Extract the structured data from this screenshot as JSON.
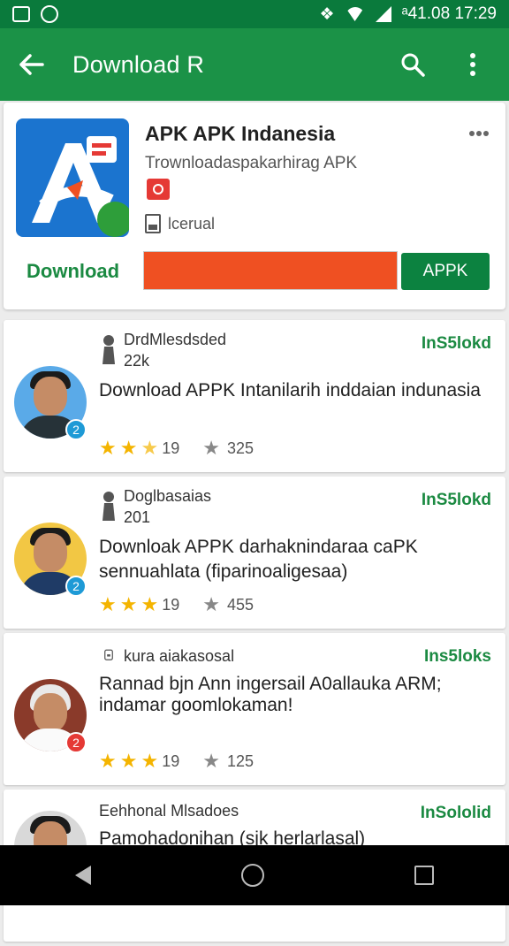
{
  "status_bar": {
    "right_text": "ᵃ41.08 17:29"
  },
  "appbar": {
    "title": "Download R"
  },
  "app": {
    "name": "APK APK Indanesia",
    "developer": "Trownloadaspakarhirag APK",
    "meta_text": "lcerual",
    "download_label": "Download",
    "progress_percent": 100,
    "apk_button": "APPK",
    "accent_color": "#ef5022",
    "brand_color": "#1b9247"
  },
  "reviews": [
    {
      "name": "DrdMlesdsded",
      "sub": "22k",
      "status": "InS5lokd",
      "text": "Download APPK Intanilarih inddaian indunasia",
      "rating": "19",
      "count": "325",
      "stars_full": 2,
      "badge": "2",
      "badge_color": "#1e9ad6"
    },
    {
      "name": "Doglbasaias",
      "sub": "201",
      "status": "InS5lokd",
      "text": "Downloak APPK darhaknindaraa caPK sennuahlata (fiparinoaligesaa)",
      "rating": "19",
      "count": "455",
      "stars_full": 3,
      "badge": "2",
      "badge_color": "#1e9ad6"
    },
    {
      "name": "kura aiakasosal",
      "sub": "",
      "status": "Ins5loks",
      "text": "Rannad bjn Ann ingersail A0allauka ARM; indamar goomlokaman!",
      "rating": "19",
      "count": "125",
      "stars_full": 3,
      "badge": "2",
      "badge_color": "#e53935"
    },
    {
      "name": "Eehhonal Mlsadoes",
      "sub": "",
      "status": "InSololid",
      "text": "Pamohadonihan (sjk herlarlasal)",
      "rating": "",
      "count": "",
      "stars_full": 0,
      "badge": "",
      "badge_color": ""
    }
  ]
}
